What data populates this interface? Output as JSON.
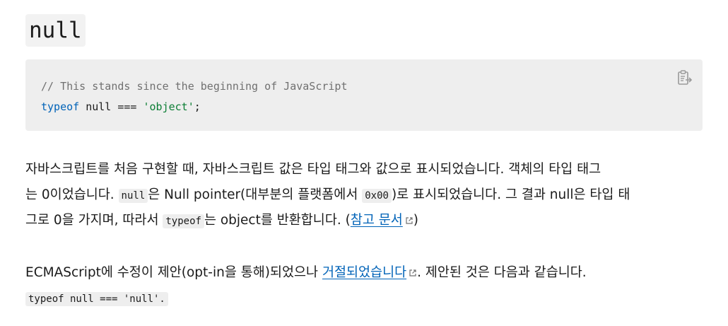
{
  "heading": "null",
  "code_block": {
    "comment": "// This stands since the beginning of JavaScript",
    "line2": {
      "keyword": "typeof",
      "middle": " null === ",
      "string": "'object'",
      "end": ";"
    },
    "copy_icon": "clipboard-copy-icon"
  },
  "paragraph1": {
    "line1": "자바스크립트를 처음 구현할 때, 자바스크립트 값은 타입 태그와 값으로 표시되었습니다. 객체의 타입 태그",
    "line2_a": "는 0이었습니다. ",
    "line2_code1": "null",
    "line2_b": "은 Null pointer(대부분의 플랫폼에서 ",
    "line2_code2": "0x00",
    "line2_c": ")로 표시되었습니다. 그 결과 null은 타입 태",
    "line3_a": "그로 0을 가지며, 따라서 ",
    "line3_code": "typeof",
    "line3_b": "는 object를 반환합니다. (",
    "line3_link": "참고 문서",
    "line3_c": ")"
  },
  "paragraph2": {
    "line1_a": "ECMAScript에 수정이 제안(opt-in을 통해)되었으나 ",
    "line1_link": "거절되었습니다",
    "line1_b": ". 제안된 것은 다음과 같습니다.",
    "line2_code": "typeof null === 'null'."
  },
  "colors": {
    "link": "#0063b8",
    "code_bg": "#eeeeee",
    "comment": "#707070",
    "string": "#0c7e35",
    "keyword": "#0063b8"
  },
  "icons": {
    "external_link": "external-link-icon"
  }
}
